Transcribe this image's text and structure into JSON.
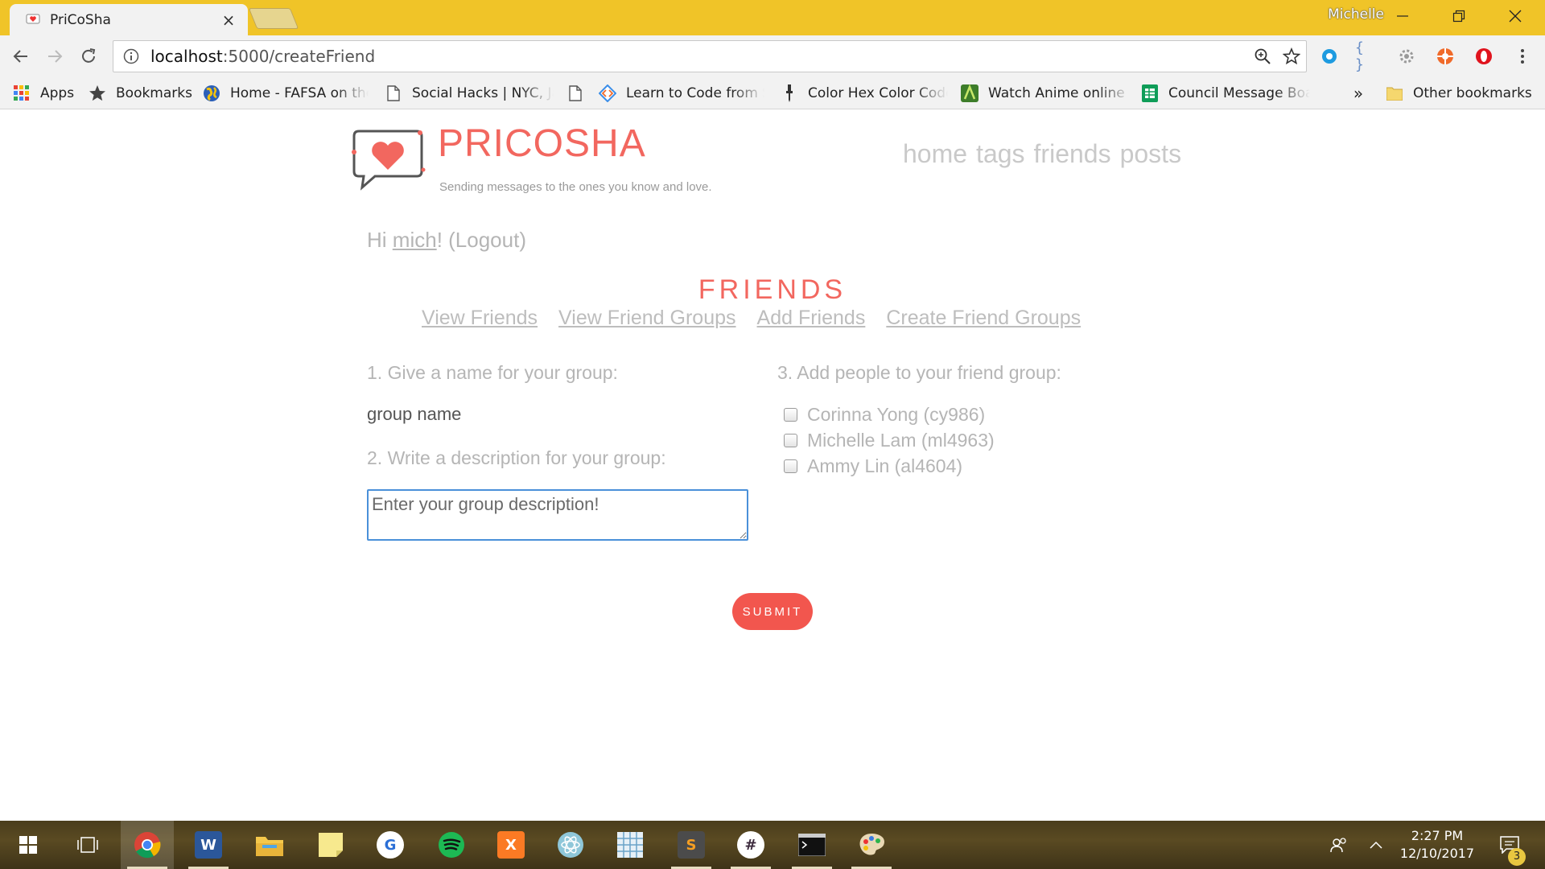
{
  "browser": {
    "tab": {
      "title": "PriCoSha",
      "close_glyph": "×",
      "favicon": "heart-chat-icon"
    },
    "profile_name": "Michelle",
    "url": {
      "host": "localhost",
      "path": ":5000/createFriend"
    },
    "bookmarks": [
      {
        "label": "Apps",
        "icon": "apps-grid-icon"
      },
      {
        "label": "Bookmarks",
        "icon": "star-icon"
      },
      {
        "label": "Home - FAFSA on the",
        "icon": "globe-icon"
      },
      {
        "label": "Social Hacks | NYC, Ja",
        "icon": "page-icon"
      },
      {
        "label": "",
        "icon": "page-icon"
      },
      {
        "label": "Learn to Code from S",
        "icon": "code-icon"
      },
      {
        "label": "Color Hex Color Code",
        "icon": "dropper-icon"
      },
      {
        "label": "Watch Anime online",
        "icon": "anime-icon"
      },
      {
        "label": "Council Message Boa",
        "icon": "sheets-icon"
      }
    ],
    "bookmarks_overflow": "»",
    "other_bookmarks": "Other bookmarks"
  },
  "site": {
    "brand": "PRICOSHA",
    "tagline": "Sending messages to the ones you know and love.",
    "nav": [
      "home",
      "tags",
      "friends",
      "posts"
    ]
  },
  "greeting": {
    "prefix": "Hi ",
    "user": "mich",
    "suffix": "! ",
    "logout": "(Logout)"
  },
  "section": {
    "title": "FRIENDS",
    "subnav": [
      "View Friends",
      "View Friend Groups",
      "Add Friends",
      "Create Friend Groups"
    ]
  },
  "form": {
    "step1": "1. Give a name for your group:",
    "name_placeholder": "group name",
    "step2": "2. Write a description for your group:",
    "description_placeholder": "Enter your group description!",
    "step3": "3. Add people to your friend group:",
    "friends": [
      "Corinna Yong (cy986)",
      "Michelle Lam (ml4963)",
      "Ammy Lin (al4604)"
    ],
    "submit": "SUBMIT"
  },
  "taskbar": {
    "time": "2:27 PM",
    "date": "12/10/2017",
    "notification_count": "3",
    "colors": {
      "accent": "#f0c428",
      "brand": "#f2675f",
      "submit": "#f2564e"
    }
  }
}
